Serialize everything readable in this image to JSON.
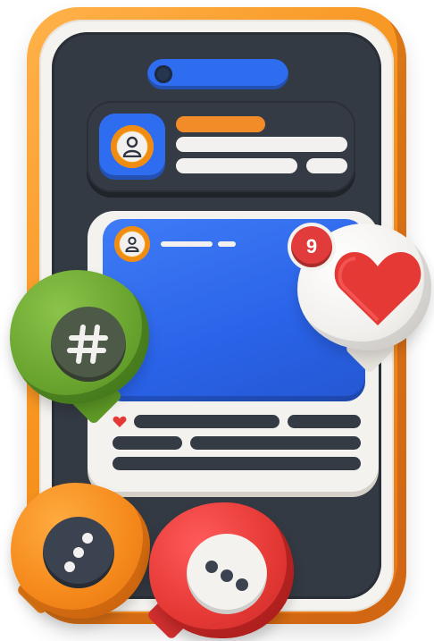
{
  "illustration": {
    "subject": "social-media-phone",
    "notification_count": "9",
    "icons": [
      "user-icon",
      "heart-icon",
      "hashtag-icon",
      "more-dots-icon",
      "chat-dots-icon"
    ]
  },
  "colors": {
    "frame_orange": "#f7931e",
    "screen_dark": "#343a43",
    "accent_blue": "#2f6df0",
    "heart_red": "#e53935",
    "hashtag_green": "#6aa52f",
    "card_light": "#f4f2ee",
    "bar_light": "#f2f1ef",
    "bar_dark": "#353b45"
  }
}
